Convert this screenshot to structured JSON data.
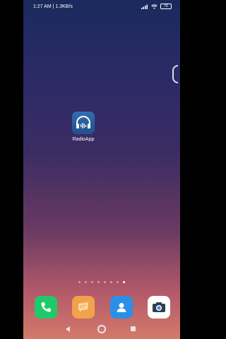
{
  "status_bar": {
    "time_speed": "1:27 AM | 1.3KB/s",
    "battery": "70"
  },
  "home": {
    "apps": [
      {
        "label": "RadioApp",
        "icon": "headphones-icon"
      }
    ],
    "page_dots": 8,
    "active_dot": 7
  },
  "dock": [
    {
      "name": "phone",
      "icon": "phone-icon",
      "color": "#1fca6b"
    },
    {
      "name": "messages",
      "icon": "message-icon",
      "color": "#f3a24c"
    },
    {
      "name": "contacts",
      "icon": "contacts-icon",
      "color": "#2b8fe8"
    },
    {
      "name": "camera",
      "icon": "camera-icon",
      "color": "#ffffff"
    }
  ]
}
